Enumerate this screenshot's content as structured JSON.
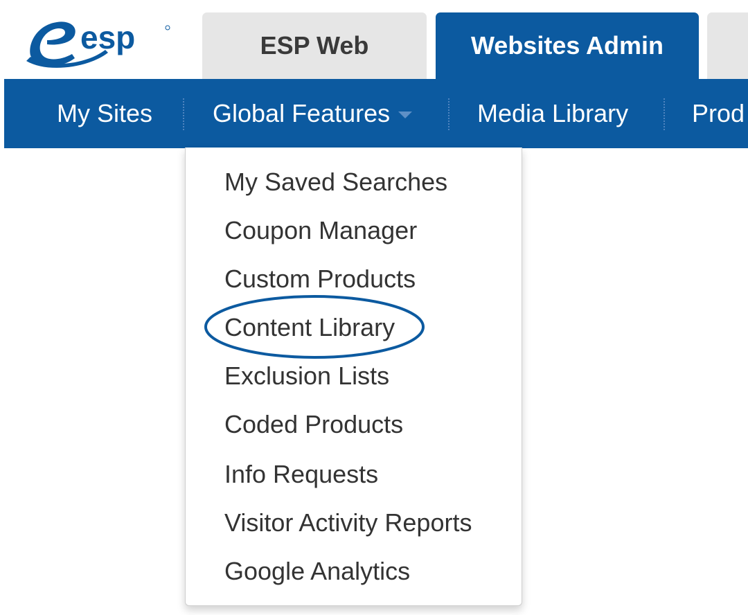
{
  "logo": {
    "text": "esp",
    "brand_color": "#0c5aa0"
  },
  "tabs": [
    {
      "label": "ESP Web",
      "active": false
    },
    {
      "label": "Websites Admin",
      "active": true
    }
  ],
  "nav": {
    "items": [
      "My Sites",
      "Global Features",
      "Media Library",
      "Prod"
    ],
    "bar_color": "#0c5aa0"
  },
  "dropdown": {
    "items": [
      "My Saved Searches",
      "Coupon Manager",
      "Custom Products",
      "Content Library",
      "Exclusion Lists",
      "Coded Products",
      "Info Requests",
      "Visitor Activity Reports",
      "Google Analytics"
    ],
    "highlighted_item": "Content Library"
  },
  "icons": {
    "logo": "esp-logo-swoosh-icon",
    "dropdown_caret": "caret-down-icon",
    "highlight": "ellipse-annotation-icon"
  }
}
